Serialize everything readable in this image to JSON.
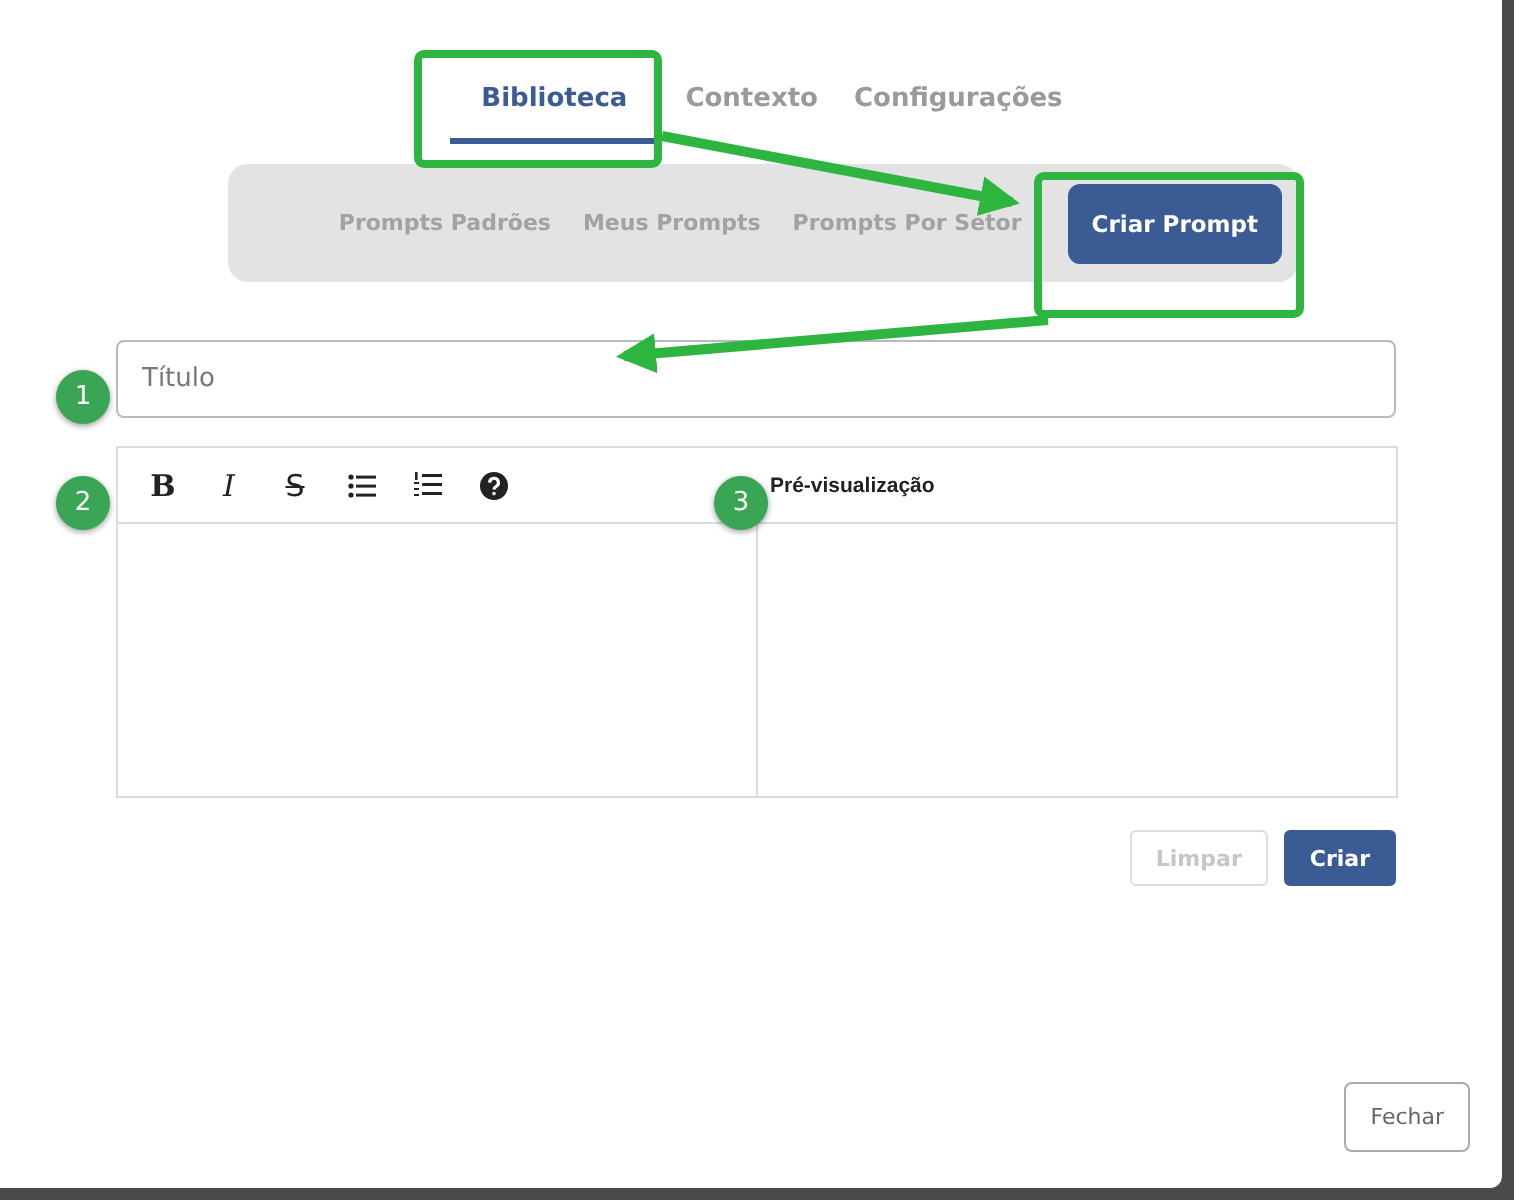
{
  "tabs": [
    {
      "label": "Biblioteca",
      "selected": true
    },
    {
      "label": "Contexto",
      "selected": false
    },
    {
      "label": "Configurações",
      "selected": false
    }
  ],
  "subtabs": [
    {
      "label": "Prompts Padrões",
      "selected": false
    },
    {
      "label": "Meus Prompts",
      "selected": false
    },
    {
      "label": "Prompts Por Setor",
      "selected": false
    },
    {
      "label": "Criar Prompt",
      "selected": true
    }
  ],
  "title_field": {
    "placeholder": "Título"
  },
  "toolbar": [
    {
      "kind": "bold",
      "label": "B"
    },
    {
      "kind": "italic",
      "label": "I"
    },
    {
      "kind": "strike",
      "label": "S"
    },
    {
      "kind": "bullet-list"
    },
    {
      "kind": "numbered-list"
    },
    {
      "kind": "help"
    }
  ],
  "preview": {
    "label": "Pré-visualização"
  },
  "actions": [
    {
      "label": "Limpar",
      "disabled": true
    },
    {
      "label": "Criar",
      "disabled": false
    }
  ],
  "close_button": {
    "label": "Fechar"
  },
  "annotations": [
    {
      "number": "1"
    },
    {
      "number": "2"
    },
    {
      "number": "3"
    }
  ]
}
